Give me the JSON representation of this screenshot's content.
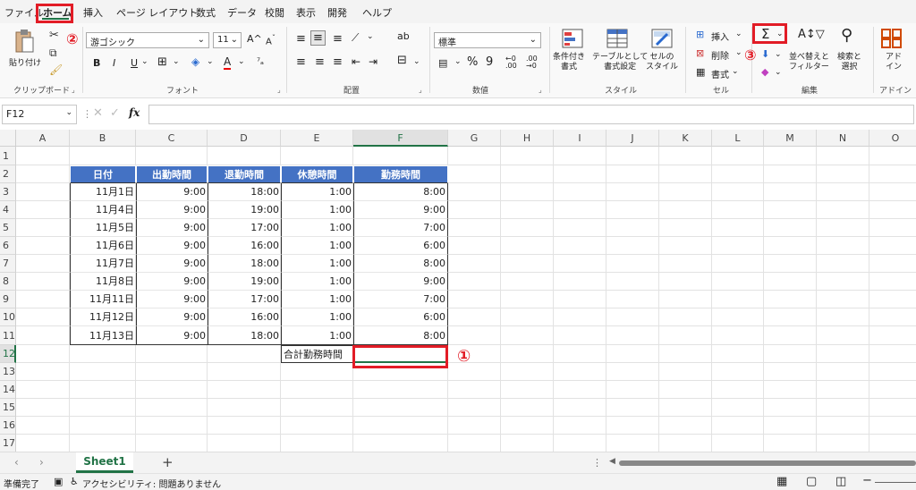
{
  "menu": {
    "items": [
      {
        "label": "ファイル"
      },
      {
        "label": "ホーム"
      },
      {
        "label": "挿入"
      },
      {
        "label": "ページ レイアウト"
      },
      {
        "label": "数式"
      },
      {
        "label": "データ"
      },
      {
        "label": "校閲"
      },
      {
        "label": "表示"
      },
      {
        "label": "開発"
      },
      {
        "label": "ヘルプ"
      }
    ]
  },
  "ribbon": {
    "clipboard": {
      "paste_label": "貼り付け",
      "group_label": "クリップボード"
    },
    "font": {
      "font_name": "游ゴシック",
      "font_size": "11",
      "grow_label": "A^",
      "shrink_label": "A",
      "bold": "B",
      "italic": "I",
      "underline": "U",
      "group_label": "フォント"
    },
    "alignment": {
      "group_label": "配置",
      "wrap_label": "ab"
    },
    "number": {
      "format": "標準",
      "percent": "%",
      "comma": "9",
      "group_label": "数値"
    },
    "styles": {
      "conditional": "条件付き\n書式",
      "table": "テーブルとして\n書式設定",
      "cell_style": "セルの\nスタイル",
      "group_label": "スタイル"
    },
    "cells": {
      "insert": "挿入",
      "delete": "削除",
      "format": "書式",
      "group_label": "セル"
    },
    "editing": {
      "autosum": "Σ",
      "sort": "並べ替えと\nフィルター",
      "find": "検索と\n選択",
      "group_label": "編集"
    },
    "addins": {
      "label": "アド\nイン",
      "group_label": "アドイン"
    }
  },
  "annotations": {
    "one": "①",
    "two": "②",
    "three": "③"
  },
  "formula_bar": {
    "name_box": "F12",
    "fx": "fx",
    "value": ""
  },
  "columns": [
    "A",
    "B",
    "C",
    "D",
    "E",
    "F",
    "G",
    "H",
    "I",
    "J",
    "K",
    "L",
    "M",
    "N",
    "O"
  ],
  "rows": [
    "1",
    "2",
    "3",
    "4",
    "5",
    "6",
    "7",
    "8",
    "9",
    "10",
    "11",
    "12",
    "13",
    "14",
    "15",
    "16",
    "17"
  ],
  "table": {
    "headers": [
      "日付",
      "出勤時間",
      "退勤時間",
      "休憩時間",
      "勤務時間"
    ],
    "rows": [
      [
        "11月1日",
        "9:00",
        "18:00",
        "1:00",
        "8:00"
      ],
      [
        "11月4日",
        "9:00",
        "19:00",
        "1:00",
        "9:00"
      ],
      [
        "11月5日",
        "9:00",
        "17:00",
        "1:00",
        "7:00"
      ],
      [
        "11月6日",
        "9:00",
        "16:00",
        "1:00",
        "6:00"
      ],
      [
        "11月7日",
        "9:00",
        "18:00",
        "1:00",
        "8:00"
      ],
      [
        "11月8日",
        "9:00",
        "19:00",
        "1:00",
        "9:00"
      ],
      [
        "11月11日",
        "9:00",
        "17:00",
        "1:00",
        "7:00"
      ],
      [
        "11月12日",
        "9:00",
        "16:00",
        "1:00",
        "6:00"
      ],
      [
        "11月13日",
        "9:00",
        "18:00",
        "1:00",
        "8:00"
      ]
    ],
    "total_label": "合計勤務時間"
  },
  "sheet_tabs": {
    "active": "Sheet1",
    "add": "+"
  },
  "status": {
    "ready": "準備完了",
    "accessibility": "アクセシビリティ: 問題ありません"
  },
  "colors": {
    "accent": "#4472c4",
    "annotation": "#e21c26",
    "excel_green": "#217346"
  }
}
